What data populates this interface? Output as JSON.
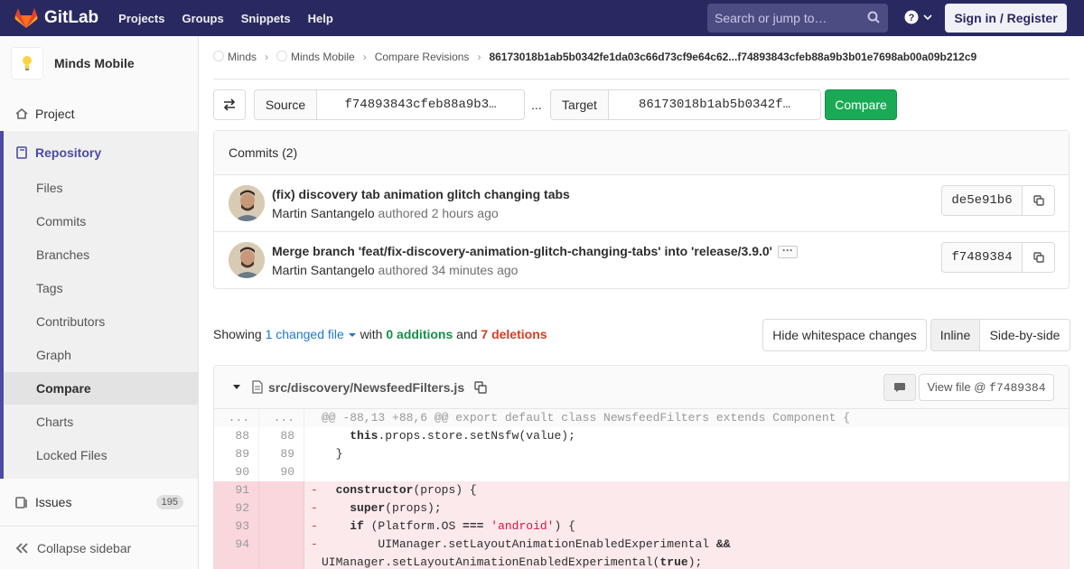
{
  "topbar": {
    "brand": "GitLab",
    "nav": [
      "Projects",
      "Groups",
      "Snippets",
      "Help"
    ],
    "search_placeholder": "Search or jump to…",
    "signin_label": "Sign in / Register"
  },
  "sidebar": {
    "project_name": "Minds Mobile",
    "project_label": "Project",
    "repository_label": "Repository",
    "repo_items": [
      "Files",
      "Commits",
      "Branches",
      "Tags",
      "Contributors",
      "Graph",
      "Compare",
      "Charts",
      "Locked Files"
    ],
    "active_item": "Compare",
    "issues_label": "Issues",
    "issues_count": "195",
    "collapse_label": "Collapse sidebar"
  },
  "breadcrumb": {
    "items": [
      "Minds",
      "Minds Mobile",
      "Compare Revisions"
    ],
    "current": "86173018b1ab5b0342fe1da03c66d73cf9e64c62...f74893843cfeb88a9b3b01e7698ab00a09b212c9"
  },
  "compare": {
    "source_label": "Source",
    "source_value": "f74893843cfeb88a9b3…",
    "separator": "...",
    "target_label": "Target",
    "target_value": "86173018b1ab5b0342f…",
    "button_label": "Compare"
  },
  "commits": {
    "header": "Commits (2)",
    "list": [
      {
        "title": "(fix) discovery tab animation glitch changing tabs",
        "author": "Martin Santangelo",
        "authored": "authored",
        "time": "2 hours ago",
        "sha": "de5e91b6"
      },
      {
        "title": "Merge branch 'feat/fix-discovery-animation-glitch-changing-tabs' into 'release/3.9.0'",
        "author": "Martin Santangelo",
        "authored": "authored",
        "time": "34 minutes ago",
        "sha": "f7489384"
      }
    ]
  },
  "summary": {
    "showing": "Showing",
    "changed": "1 changed file",
    "with": "with",
    "additions": "0 additions",
    "and": "and",
    "deletions": "7 deletions",
    "hide_ws": "Hide whitespace changes",
    "inline": "Inline",
    "side_by_side": "Side-by-side"
  },
  "diff": {
    "file_path": "src/discovery/NewsfeedFilters.js",
    "view_file": "View file @",
    "view_sha": "f7489384",
    "hunk_old": "...",
    "hunk_new": "...",
    "hunk_header": "@@ -88,13 +88,6 @@ export default class NewsfeedFilters extends Component {",
    "lines": [
      {
        "old": "88",
        "new": "88",
        "type": "context"
      },
      {
        "old": "89",
        "new": "89",
        "type": "context"
      },
      {
        "old": "90",
        "new": "90",
        "type": "context"
      },
      {
        "old": "91",
        "new": "",
        "type": "removed"
      },
      {
        "old": "92",
        "new": "",
        "type": "removed"
      },
      {
        "old": "93",
        "new": "",
        "type": "removed"
      },
      {
        "old": "94",
        "new": "",
        "type": "removed"
      }
    ],
    "tokens": {
      "this": "this",
      "set_nsfw": ".props.store.setNsfw(value);",
      "close_brace": "}",
      "minus": "-",
      "constructor": "constructor",
      "ctor_args": "(props) {",
      "super": "super",
      "super_args": "(props);",
      "if": "if",
      "platform_open": " (Platform.OS ",
      "eq": "===",
      "android": "'android'",
      "if_close": ") {",
      "ui_call": "UIManager.setLayoutAnimationEnabledExperimental ",
      "and_op": "&&",
      "ui_call_2": "UIManager.setLayoutAnimationEnabledExperimental(",
      "true": "true",
      "ui_end": ");"
    }
  },
  "colors": {
    "topbar": "#292961",
    "compare_button": "#1aaa55",
    "link_blue": "#1f78d1",
    "additions_green": "#168f48",
    "deletions_red": "#db3b21"
  }
}
